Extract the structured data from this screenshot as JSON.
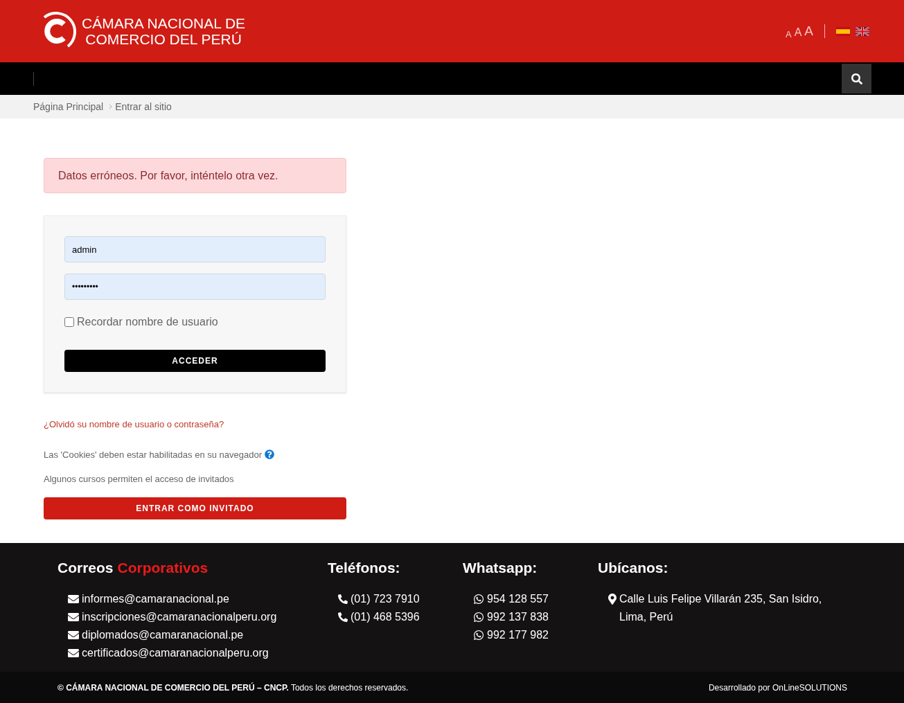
{
  "header": {
    "logo_text": [
      "CÁMARA NACIONAL DE",
      "COMERCIO DEL PERÚ"
    ],
    "font_sizes": [
      "A",
      "A",
      "A"
    ],
    "languages": [
      {
        "kind": "es",
        "selected": true
      },
      {
        "kind": "en",
        "selected": false
      }
    ]
  },
  "breadcrumb": [
    "Página Principal",
    "Entrar al sitio"
  ],
  "alert": "Datos erróneos. Por favor, inténtelo otra vez.",
  "login": {
    "username": "admin",
    "password": "•••••••••",
    "remember": {
      "label": "Recordar nombre de usuario",
      "checked": false
    },
    "submit": "ACCEDER"
  },
  "forgot_link": "¿Olvidó su nombre de usuario o contraseña?",
  "cookies_note": "Las 'Cookies' deben estar habilitadas en su navegador",
  "guest_note": "Algunos cursos permiten el acceso de invitados",
  "guest_button": "ENTRAR COMO INVITADO",
  "footer": {
    "columns": [
      {
        "kind": "email",
        "title": "Correos",
        "title_accent": "Corporativos",
        "items": [
          "informes@camaranacional.pe",
          "inscripciones@camaranacionalperu.org",
          "diplomados@camaranacional.pe",
          "certificados@camaranacionalperu.org"
        ]
      },
      {
        "kind": "phone",
        "title": "Teléfonos:",
        "items": [
          "(01) 723 7910",
          "(01) 468 5396"
        ]
      },
      {
        "kind": "whatsapp",
        "title": "Whatsapp:",
        "items": [
          "954 128 557",
          "992 137 838",
          "992 177 982"
        ]
      },
      {
        "kind": "location",
        "title": "Ubícanos:",
        "items": [
          "Calle Luis Felipe Villarán 235, San Isidro, Lima, Perú"
        ]
      }
    ],
    "copyright": "**© CÁMARA NACIONAL DE COMERCIO DEL PERÚ – CNCP.** Todos los derechos reservados.",
    "credit": "Desarrollado por OnLineSOLUTIONS"
  }
}
